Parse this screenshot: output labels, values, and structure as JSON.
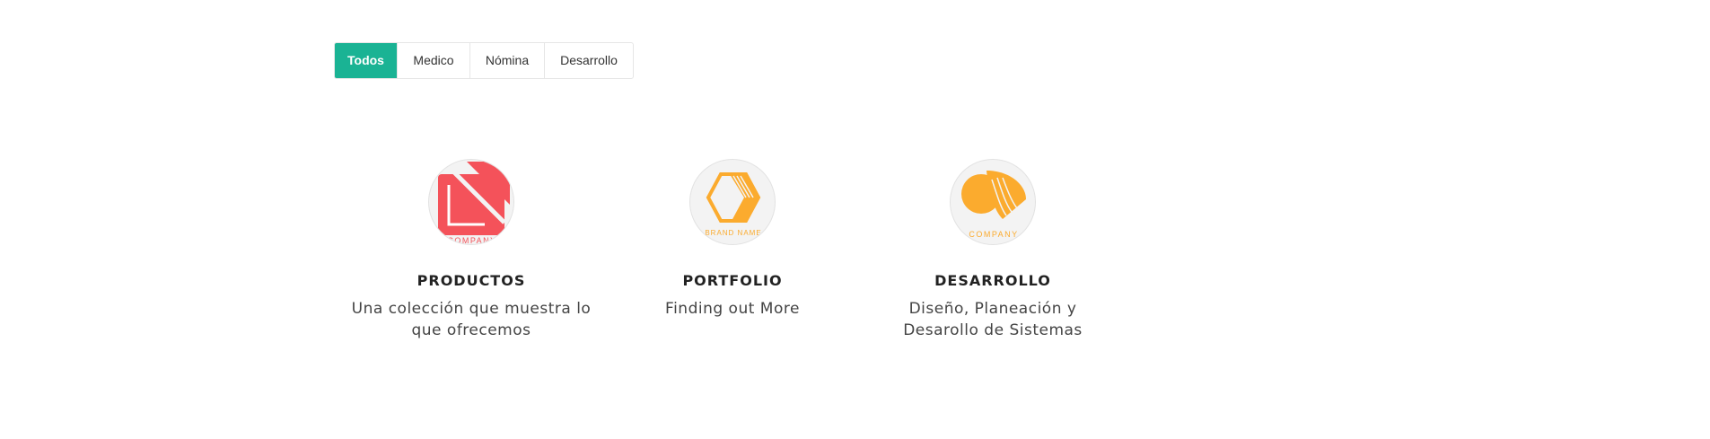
{
  "filters": {
    "tabs": [
      {
        "label": "Todos",
        "active": true
      },
      {
        "label": "Medico",
        "active": false
      },
      {
        "label": "Nómina",
        "active": false
      },
      {
        "label": "Desarrollo",
        "active": false
      }
    ],
    "active_color": "#1ab394"
  },
  "cards": [
    {
      "logo_text": "COMPANY",
      "logo_icon": "red-square-logo-icon",
      "logo_color": "#f4525a",
      "title": "PRODUCTOS",
      "description": "Una colección que muestra lo que ofrecemos"
    },
    {
      "logo_text": "BRAND NAME",
      "logo_icon": "orange-hexagon-logo-icon",
      "logo_color": "#fbab2e",
      "title": "PORTFOLIO",
      "description": "Finding out More"
    },
    {
      "logo_text": "COMPANY",
      "logo_icon": "orange-leaf-logo-icon",
      "logo_color": "#fbab2e",
      "title": "DESARROLLO",
      "description": "Diseño, Planeación y Desarollo de Sistemas"
    }
  ]
}
